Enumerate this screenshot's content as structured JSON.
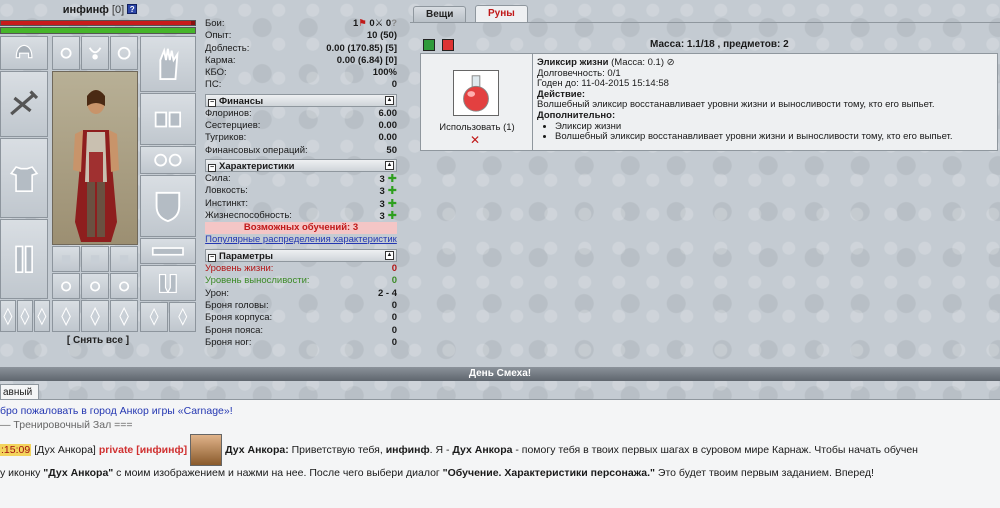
{
  "character": {
    "name": "инфинф",
    "level": "[0]",
    "help": "?",
    "hp_fraction": 0.98,
    "stamina_fraction": 1.0,
    "unequip_label": "[ Снять все ]"
  },
  "stats": {
    "battles_label": "Бои:",
    "battles_win": "1",
    "battles_lose": "0",
    "battles_draw": "0",
    "rows": [
      {
        "label": "Опыт:",
        "value": "10 (50)"
      },
      {
        "label": "Доблесть:",
        "value": "0.00 (170.85) [5]"
      },
      {
        "label": "Карма:",
        "value": "0.00 (6.84) [0]"
      },
      {
        "label": "КБО:",
        "value": "100%"
      },
      {
        "label": "ПС:",
        "value": "0"
      }
    ]
  },
  "finance": {
    "title": "Финансы",
    "rows": [
      {
        "label": "Флоринов:",
        "value": "6.00"
      },
      {
        "label": "Сестерциев:",
        "value": "0.00"
      },
      {
        "label": "Тугриков:",
        "value": "0.00"
      },
      {
        "label": "Финансовых операций:",
        "value": "50"
      }
    ]
  },
  "characteristics": {
    "title": "Характеристики",
    "rows": [
      {
        "label": "Сила:",
        "value": "3"
      },
      {
        "label": "Ловкость:",
        "value": "3"
      },
      {
        "label": "Инстинкт:",
        "value": "3"
      },
      {
        "label": "Жизнеспособность:",
        "value": "3"
      }
    ],
    "possible_learn": "Возможных обучений: 3",
    "popular_link": "Популярные распределения характеристик"
  },
  "params": {
    "title": "Параметры",
    "rows": [
      {
        "label": "Уровень жизни:",
        "value": "0"
      },
      {
        "label": "Уровень выносливости:",
        "value": "0"
      },
      {
        "label": "Урон:",
        "value": "2 - 4"
      },
      {
        "label": "Броня головы:",
        "value": "0"
      },
      {
        "label": "Броня корпуса:",
        "value": "0"
      },
      {
        "label": "Броня пояса:",
        "value": "0"
      },
      {
        "label": "Броня ног:",
        "value": "0"
      }
    ]
  },
  "tabs": {
    "things": "Вещи",
    "runes": "Руны"
  },
  "inventory": {
    "mass_text": "Масса: 1.1/18 , предметов: 2",
    "item": {
      "name": "Эликсир жизни",
      "mass": "(Масса: 0.1)",
      "durability": "Долговечность: 0/1",
      "valid_until": "Годен до: 11-04-2015 15:14:58",
      "action_title": "Действие:",
      "action_text": "Волшебный эликсир восстанавливает уровни жизни и выносливости тому, кто его выпьет.",
      "extra_title": "Дополнительно:",
      "extra_items": [
        "Эликсир жизни",
        "Волшебный эликсир восстанавливает уровни жизни и выносливости тому, кто его выпьет."
      ],
      "use_label": "Использовать (1)",
      "delete": "✕"
    }
  },
  "holiday": "День Смеха!",
  "chat": {
    "tab": "авный",
    "welcome": "бро пожаловать в город Анкор игры «Carnage»!",
    "room": "— Тренировочный Зал ===",
    "time": ":15:09",
    "sender": "[Дух Анкора]",
    "private": "private [инфинф]",
    "speaker": "Дух Анкора:",
    "msg1_a": " Приветствую тебя, ",
    "msg1_b": "инфинф",
    "msg1_c": ". Я - ",
    "msg1_d": "Дух Анкора",
    "msg1_e": " - помогу тебя в твоих первых шагах в суровом мире Карнаж. Чтобы начать обучен",
    "msg2_a": "у иконку ",
    "msg2_b": "\"Дух Анкора\"",
    "msg2_c": " с моим изображением и нажми на нее. После чего выбери диалог ",
    "msg2_d": "\"Обучение. Характеристики персонажа.\"",
    "msg2_e": " Это будет твоим первым заданием. Вперед!"
  }
}
